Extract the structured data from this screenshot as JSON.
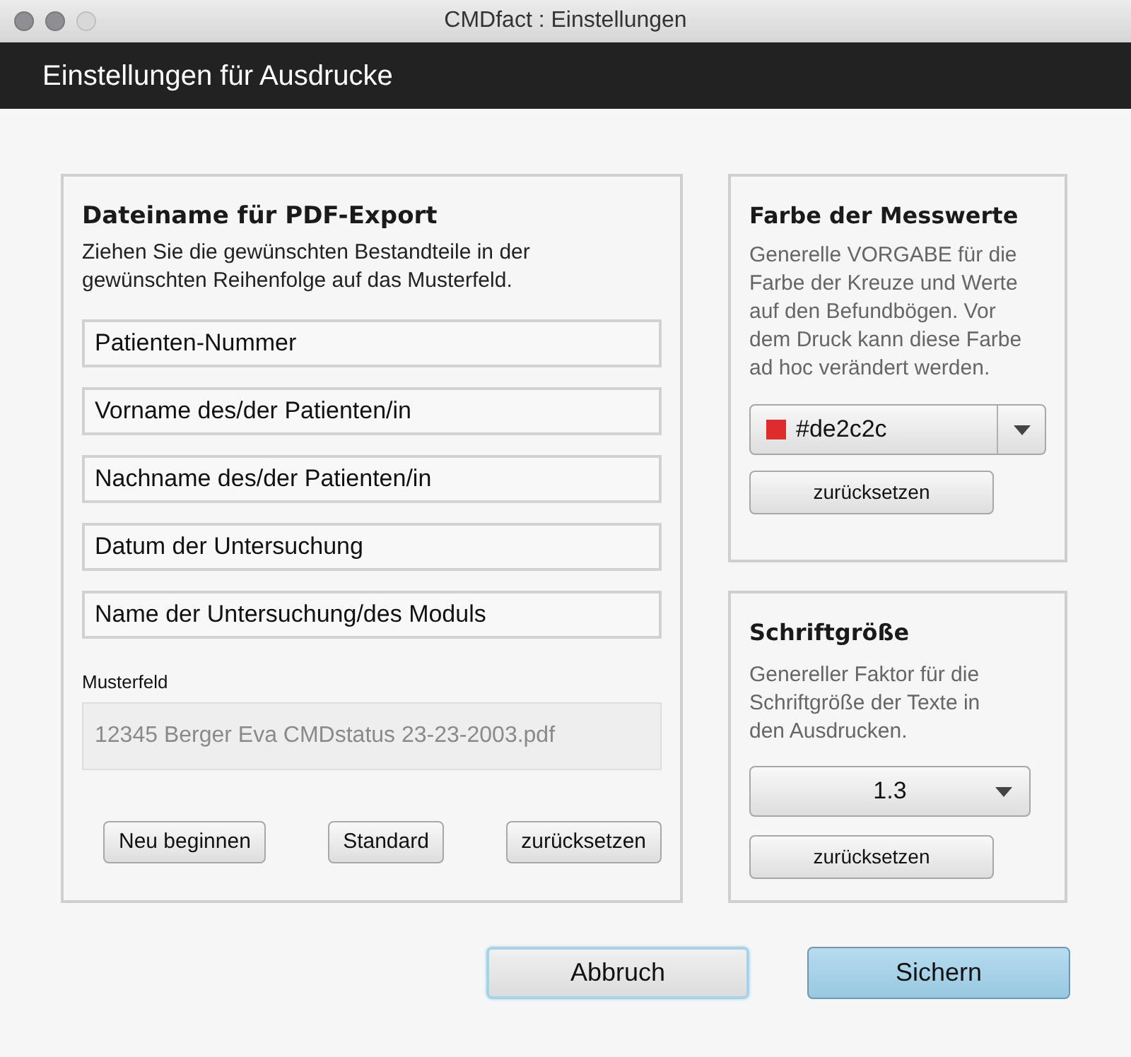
{
  "window": {
    "title": "CMDfact : Einstellungen"
  },
  "header": {
    "title": "Einstellungen für Ausdrucke"
  },
  "filename_panel": {
    "title": "Dateiname für PDF-Export",
    "description": "Ziehen Sie die gewünschten Bestandteile in der gewünschten Reihenfolge auf das Musterfeld.",
    "components": [
      "Patienten-Nummer",
      "Vorname des/der Patienten/in",
      "Nachname des/der Patienten/in",
      "Datum der Untersuchung",
      "Name der Untersuchung/des Moduls"
    ],
    "sample_label": "Musterfeld",
    "sample_value": "12345 Berger Eva CMDstatus 23-23-2003.pdf",
    "buttons": [
      "Neu beginnen",
      "Standard",
      "zurücksetzen"
    ]
  },
  "color_panel": {
    "title": "Farbe der Messwerte",
    "description": "Generelle VORGABE für die Farbe der Kreuze und Werte auf den Befundbögen. Vor dem Druck kann diese Farbe ad hoc verändert werden.",
    "value": "#de2c2c",
    "color": "#de2c2c",
    "reset_button": "zurücksetzen"
  },
  "font_panel": {
    "title": "Schriftgröße",
    "description": "Genereller Faktor für die Schriftgröße der Texte in den Ausdrucken.",
    "value": "1.3",
    "reset_button": "zurücksetzen"
  },
  "footer_buttons": [
    {
      "label": "Abbruch",
      "kind": "focused"
    },
    {
      "label": "Sichern",
      "kind": "default"
    }
  ]
}
